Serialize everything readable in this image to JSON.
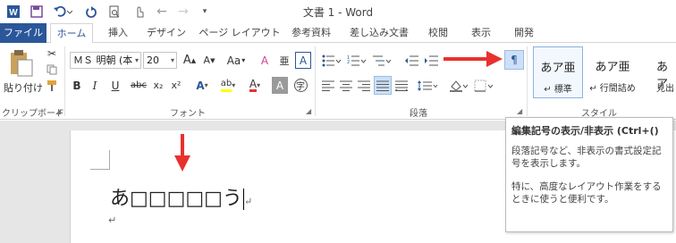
{
  "window": {
    "title": "文書 1 - Word"
  },
  "quick_access": {
    "app_icon": "word-icon",
    "save_icon": "save-icon",
    "undo_icon": "undo-icon",
    "redo_icon": "redo-icon",
    "preview_icon": "print-preview-icon",
    "pointer_icon": "touch-mode-icon",
    "back_icon": "back-arrow-icon",
    "forward_icon": "forward-arrow-icon",
    "customize_icon": "customize-qat-icon"
  },
  "tabs": [
    {
      "label": "ファイル"
    },
    {
      "label": "ホーム"
    },
    {
      "label": "挿入"
    },
    {
      "label": "デザイン"
    },
    {
      "label": "ページ レイアウト"
    },
    {
      "label": "参考資料"
    },
    {
      "label": "差し込み文書"
    },
    {
      "label": "校閲"
    },
    {
      "label": "表示"
    },
    {
      "label": "開発"
    }
  ],
  "ribbon": {
    "clipboard": {
      "label": "クリップボード",
      "paste_label": "貼り付け"
    },
    "font": {
      "label": "フォント",
      "font_name": "ＭＳ 明朝 (本",
      "font_size": "20",
      "grow": "A",
      "shrink": "A",
      "case": "Aa",
      "clear": "A",
      "ruby": "亜",
      "bold": "B",
      "italic": "I",
      "underline": "U",
      "strike": "abc",
      "sub": "x₂",
      "sup": "x²",
      "effects": "A",
      "highlight": "ab",
      "color": "A",
      "shading": "A",
      "enclose": "字"
    },
    "paragraph": {
      "label": "段落"
    },
    "styles": {
      "label": "スタイル",
      "tiles": [
        {
          "sample": "あア亜",
          "name": "↵ 標準"
        },
        {
          "sample": "あア亜",
          "name": "↵ 行間詰め"
        },
        {
          "sample": "あア",
          "name": "見出"
        }
      ]
    }
  },
  "document": {
    "line_text": "あ□□□□□う",
    "para_mark": "↵"
  },
  "tooltip": {
    "title": "編集記号の表示/非表示 (Ctrl+()",
    "body": "段落記号など、非表示の書式設定記号を表示します。",
    "body2": "特に、高度なレイアウト作業をするときに使うと便利です。"
  },
  "colors": {
    "accent": "#2b579a",
    "annotation_arrow": "#e8312e",
    "font_color_bar": "#e8312e",
    "highlight_bar": "#ffff00"
  }
}
